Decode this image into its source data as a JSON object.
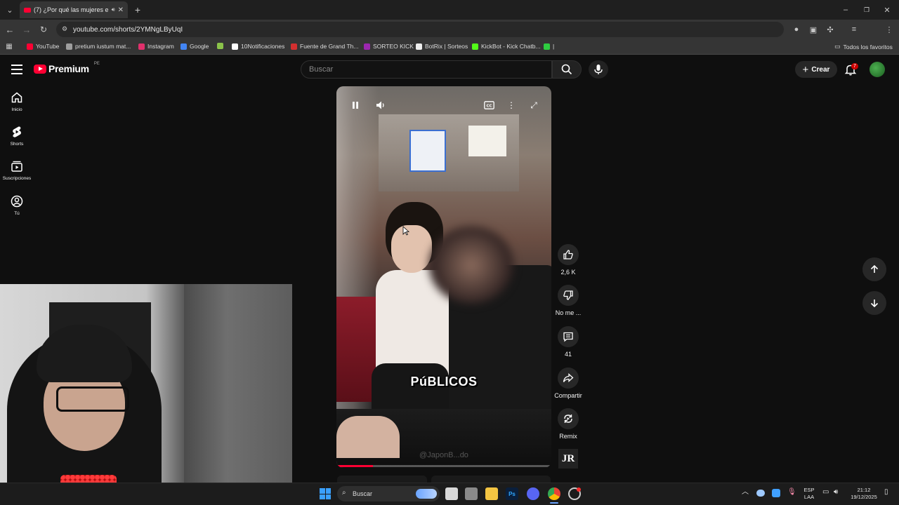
{
  "browser": {
    "tab_title": "(7) ¿Por qué las mujeres en",
    "url": "youtube.com/shorts/2YMNgLByUqI",
    "bookmarks": [
      {
        "label": "YouTube",
        "color": "#ff0033"
      },
      {
        "label": "pretium iustum mat...",
        "color": "#9e9e9e"
      },
      {
        "label": "Instagram",
        "color": "#e1306c"
      },
      {
        "label": "Google",
        "color": "#4285f4"
      },
      {
        "label": "",
        "color": "#8bc34a"
      },
      {
        "label": "10Notificaciones",
        "color": "#ffffff"
      },
      {
        "label": "Fuente de Grand Th...",
        "color": "#d32f2f"
      },
      {
        "label": "SORTEO KICK",
        "color": "#9c27b0"
      },
      {
        "label": "BotRix | Sorteos",
        "color": "#eeeeee"
      },
      {
        "label": "KickBot - Kick Chatb...",
        "color": "#53fc18"
      },
      {
        "label": "|",
        "color": "#2ecc40"
      }
    ],
    "all_bookmarks": "Todos los favoritos"
  },
  "youtube": {
    "logo_text": "Premium",
    "region": "PE",
    "search_placeholder": "Buscar",
    "create_label": "Crear",
    "notification_count": "7",
    "sidebar": [
      {
        "label": "Inicio",
        "icon": "home-icon"
      },
      {
        "label": "Shorts",
        "icon": "shorts-icon"
      },
      {
        "label": "Suscripciones",
        "icon": "subscriptions-icon"
      },
      {
        "label": "Tú",
        "icon": "you-icon"
      }
    ],
    "short": {
      "caption": "PúBLICOS",
      "watermark": "@JaponB...do",
      "progress_fraction": 0.17
    },
    "actions": {
      "like_count": "2,6 K",
      "dislike_label": "No me ...",
      "comments_count": "41",
      "share_label": "Compartir",
      "remix_label": "Remix",
      "channel_initials": "JR"
    }
  },
  "taskbar": {
    "search_label": "Buscar",
    "lang_line1": "ESP",
    "lang_line2": "LAA",
    "time": "21:12",
    "date": "19/12/2025"
  }
}
